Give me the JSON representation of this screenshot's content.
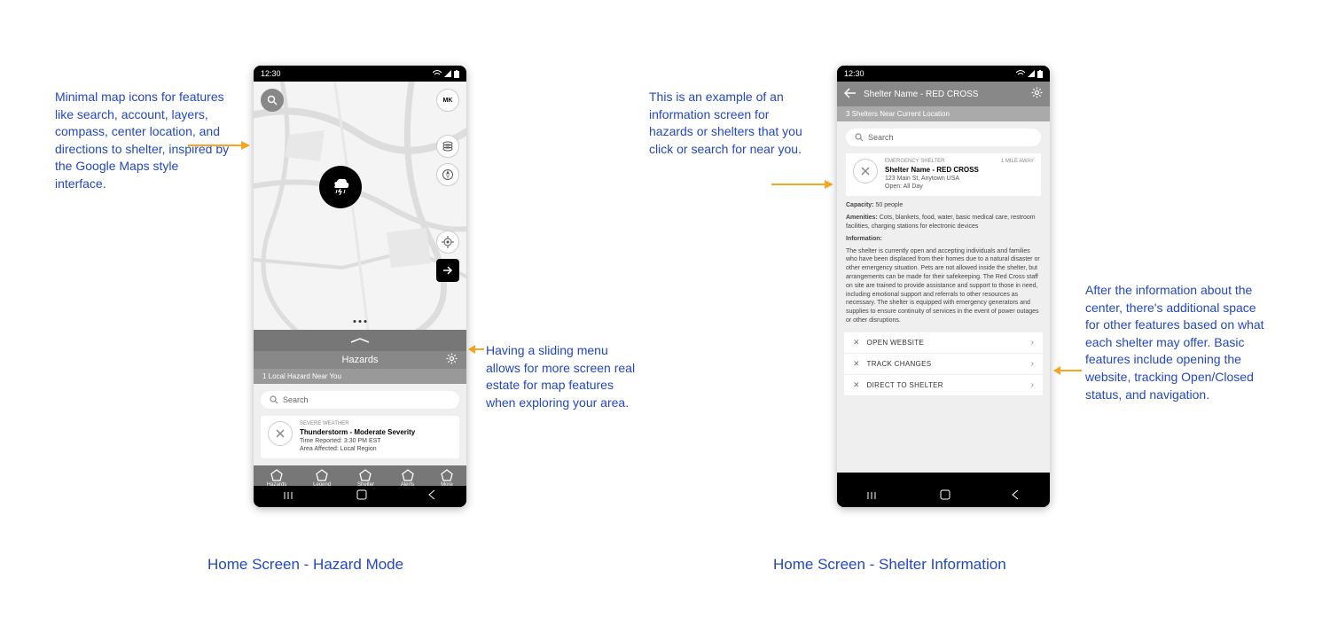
{
  "annotations": {
    "a1": "Minimal map icons for features like search, account, layers, compass, center location, and directions to shelter, inspired by the Google Maps style interface.",
    "a2": "Having a sliding menu allows for more screen real estate for map features when exploring your area.",
    "a3": "This is an example of an information screen for hazards or shelters that you click or search for near you.",
    "a4": "After the information about the center, there's additional space for other features based on what each shelter may offer. Basic features include opening the website, tracking Open/Closed status, and navigation."
  },
  "captions": {
    "c1": "Home Screen - Hazard Mode",
    "c2": "Home Screen - Shelter Information"
  },
  "status_time": "12:30",
  "phone1": {
    "account_initials": "MK",
    "panel_title": "Hazards",
    "panel_sub": "1 Local Hazard Near You",
    "search_placeholder": "Search",
    "card": {
      "category": "SEVERE WEATHER",
      "title": "Thunderstorm - Moderate Severity",
      "time": "Time Reported: 3:30 PM EST",
      "area": "Area Affected: Local Region"
    },
    "bottom_nav": [
      "Hazards",
      "Legend",
      "Shelter",
      "Alerts",
      "More"
    ]
  },
  "phone2": {
    "header_title": "Shelter Name - RED CROSS",
    "sub": "3 Shelters Near Current Location",
    "search_placeholder": "Search",
    "card": {
      "category": "EMERGENCY SHELTER",
      "distance": "1 MILE AWAY",
      "name": "Shelter Name - RED CROSS",
      "address": "123 Main St, Anytown USA",
      "hours": "Open: All Day"
    },
    "capacity_label": "Capacity:",
    "capacity_value": " 50 people",
    "amenities_label": "Amenities:",
    "amenities_value": " Cots, blankets, food, water, basic medical care, restroom facilities, charging stations for electronic devices",
    "info_label": "Information:",
    "info_text": "The shelter is currently open and accepting individuals and families who have been displaced from their homes due to a natural disaster or other emergency situation. Pets are not allowed inside the shelter, but arrangements can be made for their safekeeping. The Red Cross staff on site are trained to provide assistance and support to those in need, including emotional support and referrals to other resources as necessary. The shelter is equipped with emergency generators and supplies to ensure continuity of services in the event of power outages or other disruptions.",
    "actions": [
      "OPEN WEBSITE",
      "TRACK CHANGES",
      "DIRECT TO SHELTER"
    ]
  }
}
